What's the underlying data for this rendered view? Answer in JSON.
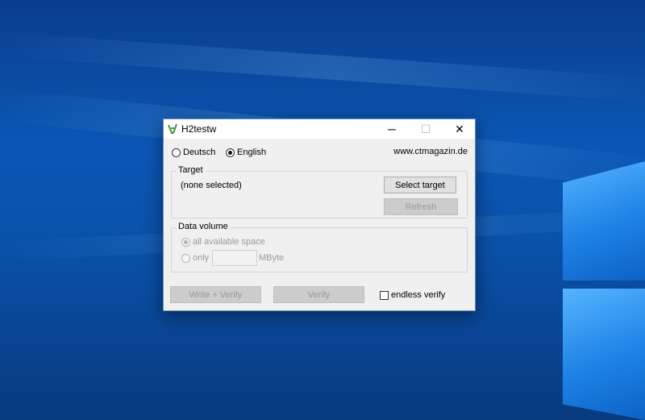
{
  "window": {
    "title": "H2testw",
    "icon": "h2testw-app-icon",
    "controls": {
      "minimize": "─",
      "maximize": "☐",
      "close": "✕"
    }
  },
  "language": {
    "options": [
      {
        "label": "Deutsch",
        "selected": false
      },
      {
        "label": "English",
        "selected": true
      }
    ]
  },
  "website": "www.ctmagazin.de",
  "target": {
    "group_label": "Target",
    "value": "(none selected)",
    "select_button": "Select target",
    "refresh_button": "Refresh"
  },
  "data_volume": {
    "group_label": "Data volume",
    "option_all": "all available space",
    "option_only": "only",
    "only_value": "",
    "unit": "MByte"
  },
  "actions": {
    "write_verify_button": "Write + Verify",
    "verify_button": "Verify",
    "endless_verify_label": "endless verify",
    "endless_verify_checked": false
  },
  "colors": {
    "desktop_blue": "#0b57b5",
    "window_bg": "#f0f0f0",
    "disabled_text": "#9a9a9a"
  }
}
